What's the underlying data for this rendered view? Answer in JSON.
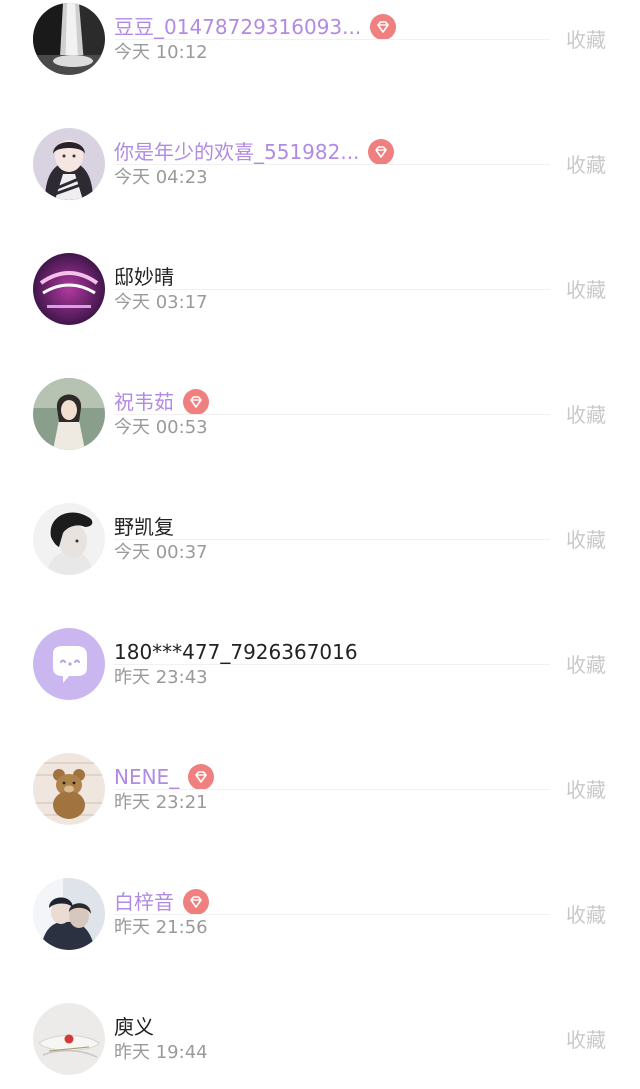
{
  "list": {
    "collect_label": "收藏",
    "items": [
      {
        "name": "豆豆_01478729316093...",
        "time": "今天 10:12",
        "vip": true
      },
      {
        "name": "你是年少的欢喜_551982...",
        "time": "今天 04:23",
        "vip": true
      },
      {
        "name": "邸妙晴",
        "time": "今天 03:17",
        "vip": false
      },
      {
        "name": "祝韦茹",
        "time": "今天 00:53",
        "vip": true
      },
      {
        "name": "野凯复",
        "time": "今天 00:37",
        "vip": false
      },
      {
        "name": "180***477_7926367016",
        "time": "昨天 23:43",
        "vip": false
      },
      {
        "name": "NENE_",
        "time": "昨天 23:21",
        "vip": true
      },
      {
        "name": "白梓音",
        "time": "昨天 21:56",
        "vip": true
      },
      {
        "name": "庾义",
        "time": "昨天 19:44",
        "vip": false
      }
    ]
  },
  "colors": {
    "vip_name": "#b18be3",
    "normal_name": "#222222",
    "time": "#9a9a9a",
    "collect": "#c9c9c9",
    "vip_badge": "#f07f7f"
  }
}
